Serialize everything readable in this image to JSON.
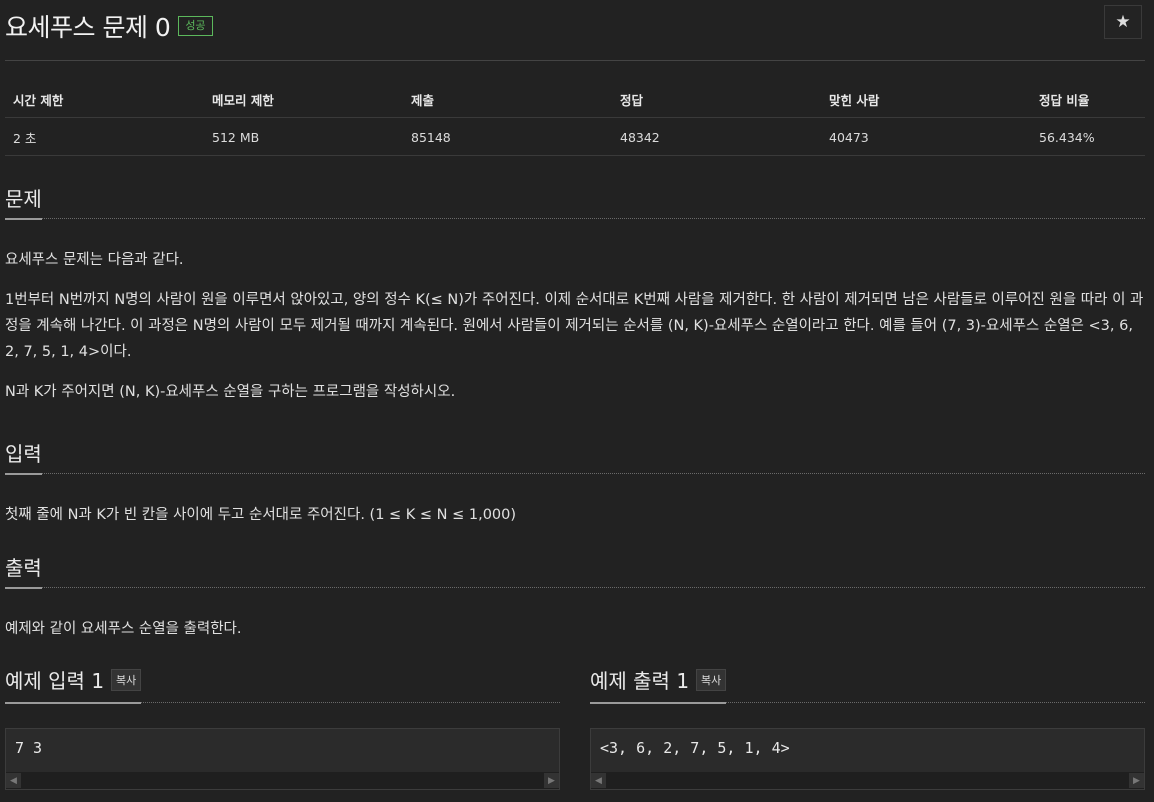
{
  "header": {
    "title": "요세푸스 문제 0",
    "badge": "성공",
    "star_icon": "★"
  },
  "info_table": {
    "headers": [
      "시간 제한",
      "메모리 제한",
      "제출",
      "정답",
      "맞힌 사람",
      "정답 비율"
    ],
    "values": [
      "2 초",
      "512 MB",
      "85148",
      "48342",
      "40473",
      "56.434%"
    ]
  },
  "problem": {
    "heading": "문제",
    "paragraphs": [
      "요세푸스 문제는 다음과 같다.",
      "1번부터 N번까지 N명의 사람이 원을 이루면서 앉아있고, 양의 정수 K(≤ N)가 주어진다. 이제 순서대로 K번째 사람을 제거한다. 한 사람이 제거되면 남은 사람들로 이루어진 원을 따라 이 과정을 계속해 나간다. 이 과정은 N명의 사람이 모두 제거될 때까지 계속된다. 원에서 사람들이 제거되는 순서를 (N, K)-요세푸스 순열이라고 한다. 예를 들어 (7, 3)-요세푸스 순열은 <3, 6, 2, 7, 5, 1, 4>이다.",
      "N과 K가 주어지면 (N, K)-요세푸스 순열을 구하는 프로그램을 작성하시오."
    ]
  },
  "input": {
    "heading": "입력",
    "text": "첫째 줄에 N과 K가 빈 칸을 사이에 두고 순서대로 주어진다. (1 ≤ K ≤ N ≤ 1,000)"
  },
  "output": {
    "heading": "출력",
    "text": "예제와 같이 요세푸스 순열을 출력한다."
  },
  "sample_input": {
    "heading": "예제 입력 1",
    "copy_label": "복사",
    "code": "7 3"
  },
  "sample_output": {
    "heading": "예제 출력 1",
    "copy_label": "복사",
    "code": "<3, 6, 2, 7, 5, 1, 4>"
  },
  "scroll_icons": {
    "left": "◀",
    "right": "▶"
  }
}
